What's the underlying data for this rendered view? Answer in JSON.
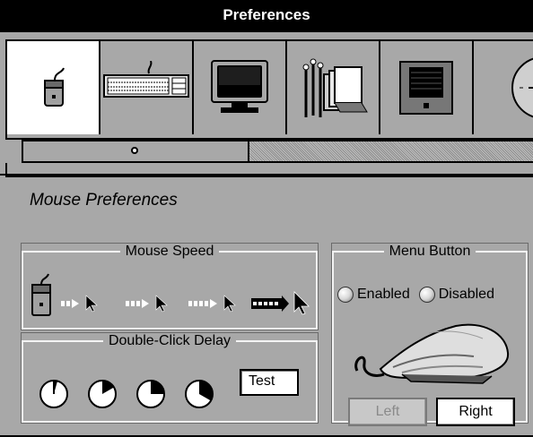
{
  "window": {
    "title": "Preferences"
  },
  "shelf": {
    "tiles": [
      {
        "icon": "mouse-icon",
        "selected": true
      },
      {
        "icon": "keyboard-icon",
        "selected": false
      },
      {
        "icon": "monitor-icon",
        "selected": false
      },
      {
        "icon": "documents-icon",
        "selected": false
      },
      {
        "icon": "disk-drive-icon",
        "selected": false
      },
      {
        "icon": "clock-icon",
        "selected": false
      }
    ]
  },
  "pane": {
    "title": "Mouse Preferences"
  },
  "mouse_speed": {
    "legend": "Mouse Speed",
    "levels": 4,
    "selected_level": 4
  },
  "double_click": {
    "legend": "Double-Click Delay",
    "delays": 4,
    "selected_delay": 3,
    "test_label": "Test"
  },
  "menu_button": {
    "legend": "Menu Button",
    "enabled_label": "Enabled",
    "disabled_label": "Disabled",
    "left_label": "Left",
    "right_label": "Right"
  },
  "colors": {
    "titlebar": "#000000",
    "background": "#a8a8a8",
    "selected_tile": "#ffffff"
  }
}
